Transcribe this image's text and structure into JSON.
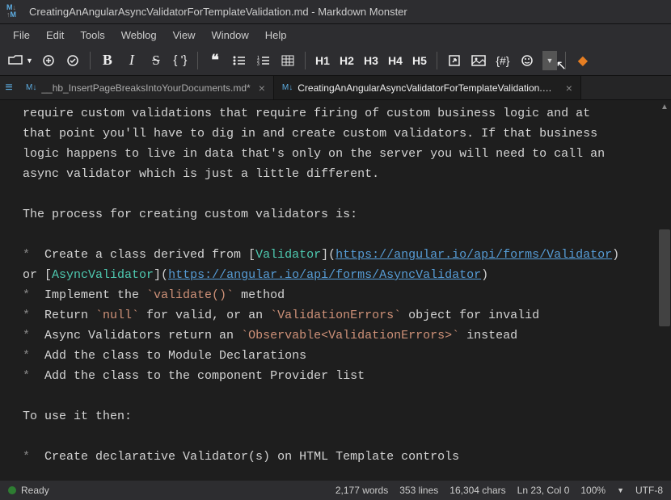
{
  "title": "CreatingAnAngularAsyncValidatorForTemplateValidation.md  - Markdown Monster",
  "menu": [
    "File",
    "Edit",
    "Tools",
    "Weblog",
    "View",
    "Window",
    "Help"
  ],
  "toolbar": {
    "h1": "H1",
    "h2": "H2",
    "h3": "H3",
    "h4": "H4",
    "h5": "H5",
    "hash": "{#}"
  },
  "tabs": [
    {
      "label": "__hb_InsertPageBreaksIntoYourDocuments.md*",
      "active": false
    },
    {
      "label": "CreatingAnAngularAsyncValidatorForTemplateValidation.md*",
      "active": true
    }
  ],
  "editor": {
    "l1a": "require custom validations that require firing of custom business logic and at",
    "l1b": "that point you'll have to dig in and create custom validators. If that business",
    "l1c": "logic happens to live in data that's only on the server you will need to call an",
    "l1d": "async validator which is just a little different.",
    "l3": "The process for creating custom validators is:",
    "b1a": "* ",
    "b1b": " Create a class derived from [",
    "b1c": "Validator",
    "b1d": "](",
    "b1e": "https://angular.io/api/forms/Validator",
    "b1f": ")",
    "b2a": "or [",
    "b2b": "AsyncValidator",
    "b2c": "](",
    "b2d": "https://angular.io/api/forms/AsyncValidator",
    "b2e": ")",
    "b3a": "* ",
    "b3b": " Implement the ",
    "b3c": "`validate()`",
    "b3d": " method",
    "b4a": "* ",
    "b4b": " Return ",
    "b4c": "`null`",
    "b4d": " for valid, or an ",
    "b4e": "`ValidationErrors`",
    "b4f": " object for invalid",
    "b5a": "* ",
    "b5b": " Async Validators return an ",
    "b5c": "`Observable<ValidationErrors>`",
    "b5d": " instead",
    "b6a": "* ",
    "b6b": " Add the class to Module Declarations",
    "b7a": "* ",
    "b7b": " Add the class to the component Provider list",
    "l8": "To use it then:",
    "b8a": "* ",
    "b8b": " Create declarative Validator(s) on HTML Template controls"
  },
  "status": {
    "ready": "Ready",
    "words": "2,177 words",
    "lines": "353 lines",
    "chars": "16,304 chars",
    "pos": "Ln 23, Col 0",
    "zoom": "100%",
    "enc": "UTF-8"
  }
}
